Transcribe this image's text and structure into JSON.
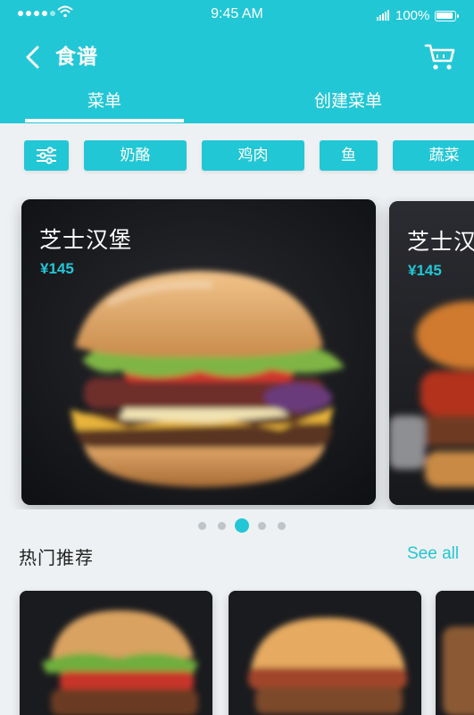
{
  "status_bar": {
    "time": "9:45 AM",
    "battery": "100%"
  },
  "header": {
    "title": "食谱",
    "back_icon": "chevron-left-icon",
    "cart_icon": "cart-icon"
  },
  "tabs": [
    {
      "label": "菜单",
      "active": true
    },
    {
      "label": "创建菜单",
      "active": false
    }
  ],
  "filters": {
    "filter_icon": "sliders-icon",
    "chips": [
      "奶酪",
      "鸡肉",
      "鱼",
      "蔬菜"
    ]
  },
  "featured": [
    {
      "name": "芝士汉堡",
      "price": "¥145"
    },
    {
      "name": "芝士汉",
      "price": "¥145"
    }
  ],
  "carousel_dots": {
    "count": 5,
    "active_index": 2
  },
  "popular_section": {
    "title": "热门推荐",
    "see_all": "See all"
  },
  "colors": {
    "accent": "#22c7d6",
    "card_bg": "#141518",
    "page_bg": "#eef1f3"
  }
}
